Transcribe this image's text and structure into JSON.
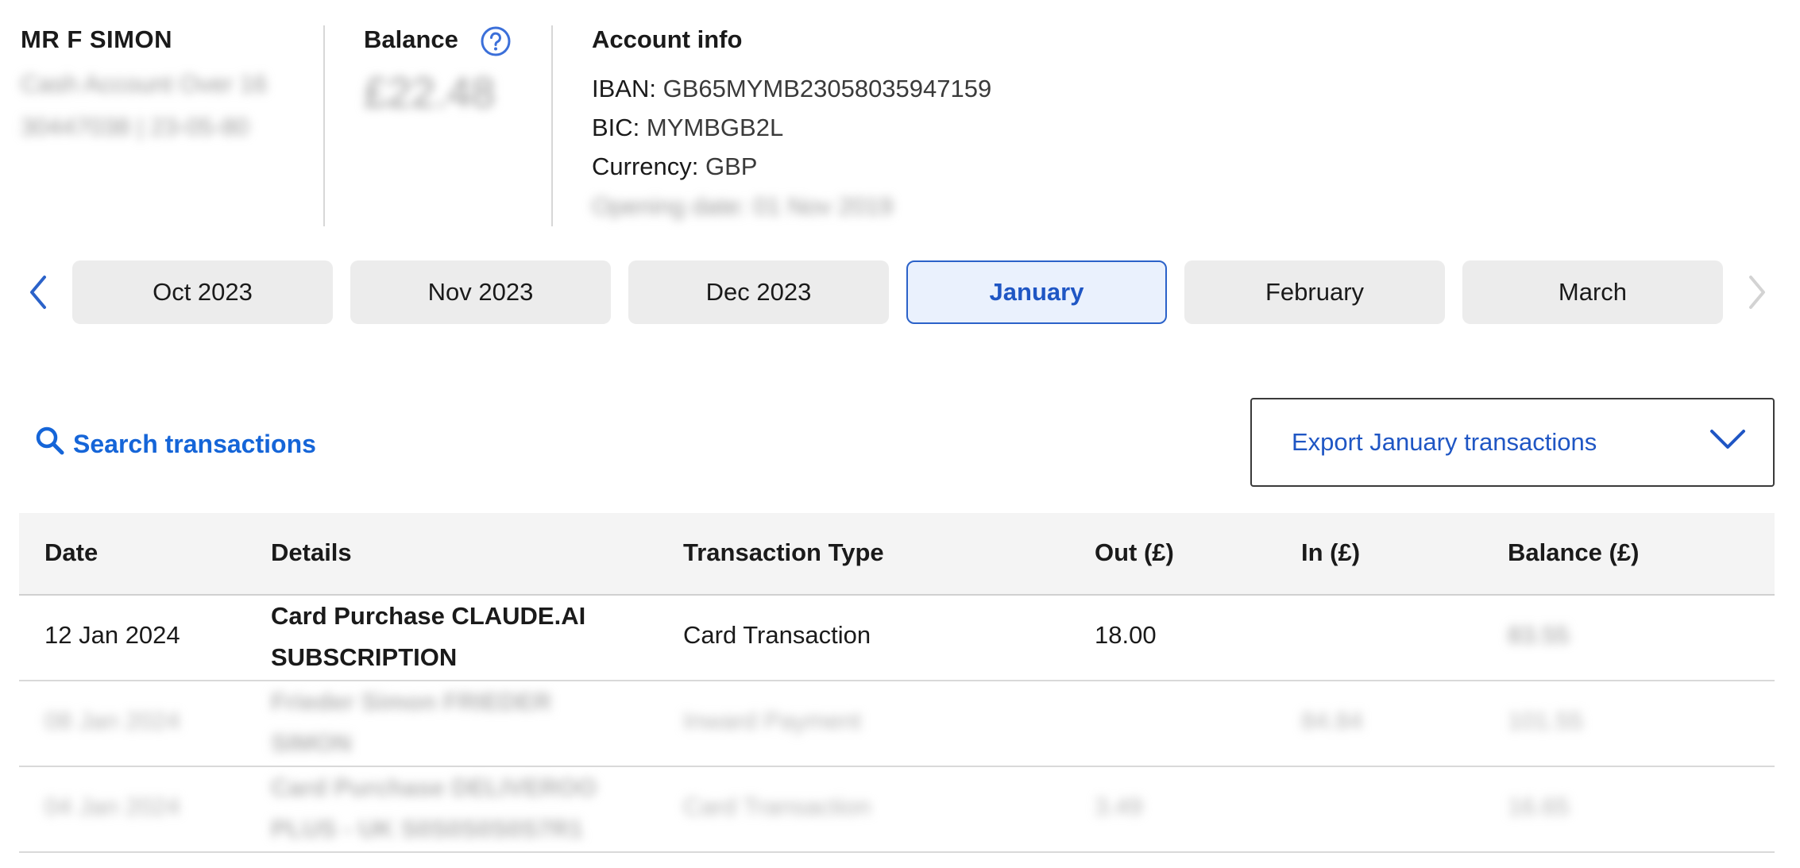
{
  "account": {
    "holder_name": "MR F SIMON",
    "account_type": "Cash Account Over 16",
    "account_number_sort": "30447038 | 23-05-80",
    "balance_label": "Balance",
    "balance_value": "£22.48",
    "help_icon": "question-circle-icon"
  },
  "account_info": {
    "title": "Account info",
    "iban_label": "IBAN:",
    "iban_value": "GB65MYMB23058035947159",
    "bic_label": "BIC:",
    "bic_value": "MYMBGB2L",
    "currency_label": "Currency:",
    "currency_value": "GBP",
    "opening_label": "Opening date:",
    "opening_value": "01 Nov 2019"
  },
  "months": {
    "prev_icon": "chevron-left-icon",
    "next_icon": "chevron-right-icon",
    "tabs": [
      {
        "label": "Oct 2023",
        "active": false
      },
      {
        "label": "Nov 2023",
        "active": false
      },
      {
        "label": "Dec 2023",
        "active": false
      },
      {
        "label": "January",
        "active": true
      },
      {
        "label": "February",
        "active": false
      },
      {
        "label": "March",
        "active": false
      }
    ]
  },
  "search": {
    "label": "Search transactions",
    "icon": "search-icon"
  },
  "export": {
    "label": "Export January transactions",
    "icon": "chevron-down-icon"
  },
  "table": {
    "headers": [
      "Date",
      "Details",
      "Transaction Type",
      "Out (£)",
      "In (£)",
      "Balance (£)"
    ],
    "rows": [
      {
        "date": "12 Jan 2024",
        "details_1": "Card Purchase CLAUDE.AI",
        "details_2": "SUBSCRIPTION",
        "type": "Card Transaction",
        "out": "18.00",
        "in": "",
        "balance": "83.55"
      },
      {
        "date": "08 Jan 2024",
        "details_1": "Frieder Simon FRIEDER",
        "details_2": "SIMON",
        "type": "Inward Payment",
        "out": "",
        "in": "84.84",
        "balance": "101.55"
      },
      {
        "date": "04 Jan 2024",
        "details_1": "Card Purchase DELIVEROO",
        "details_2": "PLUS - UK S0S0S0S0S7R1",
        "type": "Card Transaction",
        "out": "3.49",
        "in": "",
        "balance": "16.65"
      }
    ]
  },
  "colors": {
    "accent": "#1565d8",
    "active_tab_bg": "#eaf1fd",
    "active_tab_border": "#2b62c9",
    "tab_bg": "#ececec",
    "header_bg": "#f4f4f4"
  }
}
